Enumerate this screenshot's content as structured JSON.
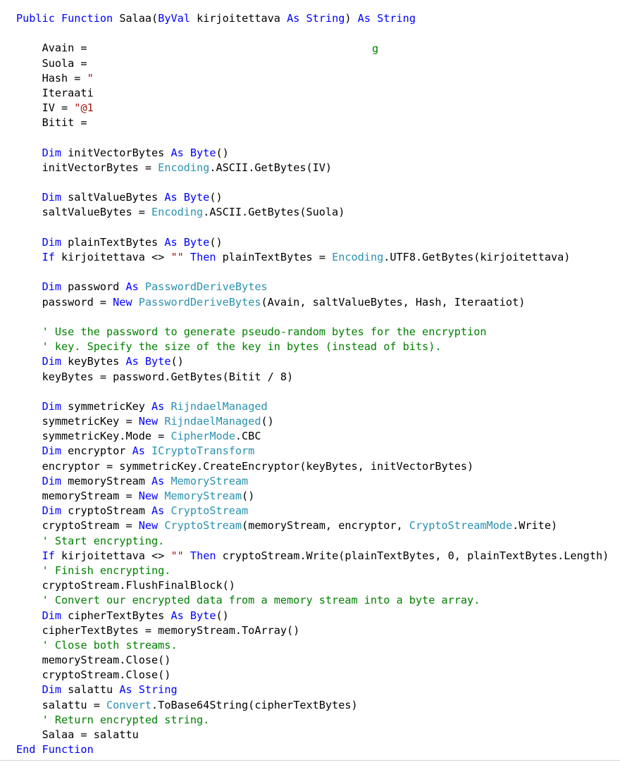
{
  "colors": {
    "keyword": "#0000ff",
    "type": "#2b91af",
    "string": "#a31515",
    "comment": "#008000",
    "plain": "#000000",
    "background": "#ffffff"
  },
  "stray_fragment": "g",
  "lines": [
    [
      [
        "kw",
        "Public Function "
      ],
      [
        "plain",
        "Salaa("
      ],
      [
        "kw",
        "ByVal "
      ],
      [
        "plain",
        "kirjoitettava "
      ],
      [
        "kw",
        "As String"
      ],
      [
        "plain",
        ") "
      ],
      [
        "kw",
        "As String"
      ]
    ],
    [],
    [
      [
        "plain",
        "    Avain = "
      ]
    ],
    [
      [
        "plain",
        "    Suola = "
      ]
    ],
    [
      [
        "plain",
        "    Hash = "
      ],
      [
        "str",
        "\""
      ]
    ],
    [
      [
        "plain",
        "    Iteraati"
      ]
    ],
    [
      [
        "plain",
        "    IV = "
      ],
      [
        "str",
        "\"@1"
      ]
    ],
    [
      [
        "plain",
        "    Bitit = "
      ]
    ],
    [],
    [
      [
        "plain",
        "    "
      ],
      [
        "kw",
        "Dim "
      ],
      [
        "plain",
        "initVectorBytes "
      ],
      [
        "kw",
        "As Byte"
      ],
      [
        "plain",
        "()"
      ]
    ],
    [
      [
        "plain",
        "    initVectorBytes = "
      ],
      [
        "type",
        "Encoding"
      ],
      [
        "plain",
        ".ASCII.GetBytes(IV)"
      ]
    ],
    [],
    [
      [
        "plain",
        "    "
      ],
      [
        "kw",
        "Dim "
      ],
      [
        "plain",
        "saltValueBytes "
      ],
      [
        "kw",
        "As Byte"
      ],
      [
        "plain",
        "()"
      ]
    ],
    [
      [
        "plain",
        "    saltValueBytes = "
      ],
      [
        "type",
        "Encoding"
      ],
      [
        "plain",
        ".ASCII.GetBytes(Suola)"
      ]
    ],
    [],
    [
      [
        "plain",
        "    "
      ],
      [
        "kw",
        "Dim "
      ],
      [
        "plain",
        "plainTextBytes "
      ],
      [
        "kw",
        "As Byte"
      ],
      [
        "plain",
        "()"
      ]
    ],
    [
      [
        "plain",
        "    "
      ],
      [
        "kw",
        "If "
      ],
      [
        "plain",
        "kirjoitettava <> "
      ],
      [
        "str",
        "\"\""
      ],
      [
        "plain",
        " "
      ],
      [
        "kw",
        "Then "
      ],
      [
        "plain",
        "plainTextBytes = "
      ],
      [
        "type",
        "Encoding"
      ],
      [
        "plain",
        ".UTF8.GetBytes(kirjoitettava)"
      ]
    ],
    [],
    [
      [
        "plain",
        "    "
      ],
      [
        "kw",
        "Dim "
      ],
      [
        "plain",
        "password "
      ],
      [
        "kw",
        "As "
      ],
      [
        "type",
        "PasswordDeriveBytes"
      ]
    ],
    [
      [
        "plain",
        "    password = "
      ],
      [
        "kw",
        "New "
      ],
      [
        "type",
        "PasswordDeriveBytes"
      ],
      [
        "plain",
        "(Avain, saltValueBytes, Hash, Iteraatiot)"
      ]
    ],
    [],
    [
      [
        "plain",
        "    "
      ],
      [
        "cm",
        "' Use the password to generate pseudo-random bytes for the encryption"
      ]
    ],
    [
      [
        "plain",
        "    "
      ],
      [
        "cm",
        "' key. Specify the size of the key in bytes (instead of bits)."
      ]
    ],
    [
      [
        "plain",
        "    "
      ],
      [
        "kw",
        "Dim "
      ],
      [
        "plain",
        "keyBytes "
      ],
      [
        "kw",
        "As Byte"
      ],
      [
        "plain",
        "()"
      ]
    ],
    [
      [
        "plain",
        "    keyBytes = password.GetBytes(Bitit / 8)"
      ]
    ],
    [],
    [
      [
        "plain",
        "    "
      ],
      [
        "kw",
        "Dim "
      ],
      [
        "plain",
        "symmetricKey "
      ],
      [
        "kw",
        "As "
      ],
      [
        "type",
        "RijndaelManaged"
      ]
    ],
    [
      [
        "plain",
        "    symmetricKey = "
      ],
      [
        "kw",
        "New "
      ],
      [
        "type",
        "RijndaelManaged"
      ],
      [
        "plain",
        "()"
      ]
    ],
    [
      [
        "plain",
        "    symmetricKey.Mode = "
      ],
      [
        "type",
        "CipherMode"
      ],
      [
        "plain",
        ".CBC"
      ]
    ],
    [
      [
        "plain",
        "    "
      ],
      [
        "kw",
        "Dim "
      ],
      [
        "plain",
        "encryptor "
      ],
      [
        "kw",
        "As "
      ],
      [
        "type",
        "ICryptoTransform"
      ]
    ],
    [
      [
        "plain",
        "    encryptor = symmetricKey.CreateEncryptor(keyBytes, initVectorBytes)"
      ]
    ],
    [
      [
        "plain",
        "    "
      ],
      [
        "kw",
        "Dim "
      ],
      [
        "plain",
        "memoryStream "
      ],
      [
        "kw",
        "As "
      ],
      [
        "type",
        "MemoryStream"
      ]
    ],
    [
      [
        "plain",
        "    memoryStream = "
      ],
      [
        "kw",
        "New "
      ],
      [
        "type",
        "MemoryStream"
      ],
      [
        "plain",
        "()"
      ]
    ],
    [
      [
        "plain",
        "    "
      ],
      [
        "kw",
        "Dim "
      ],
      [
        "plain",
        "cryptoStream "
      ],
      [
        "kw",
        "As "
      ],
      [
        "type",
        "CryptoStream"
      ]
    ],
    [
      [
        "plain",
        "    cryptoStream = "
      ],
      [
        "kw",
        "New "
      ],
      [
        "type",
        "CryptoStream"
      ],
      [
        "plain",
        "(memoryStream, encryptor, "
      ],
      [
        "type",
        "CryptoStreamMode"
      ],
      [
        "plain",
        ".Write)"
      ]
    ],
    [
      [
        "plain",
        "    "
      ],
      [
        "cm",
        "' Start encrypting."
      ]
    ],
    [
      [
        "plain",
        "    "
      ],
      [
        "kw",
        "If "
      ],
      [
        "plain",
        "kirjoitettava <> "
      ],
      [
        "str",
        "\"\""
      ],
      [
        "plain",
        " "
      ],
      [
        "kw",
        "Then "
      ],
      [
        "plain",
        "cryptoStream.Write(plainTextBytes, 0, plainTextBytes.Length)"
      ]
    ],
    [
      [
        "plain",
        "    "
      ],
      [
        "cm",
        "' Finish encrypting."
      ]
    ],
    [
      [
        "plain",
        "    cryptoStream.FlushFinalBlock()"
      ]
    ],
    [
      [
        "plain",
        "    "
      ],
      [
        "cm",
        "' Convert our encrypted data from a memory stream into a byte array."
      ]
    ],
    [
      [
        "plain",
        "    "
      ],
      [
        "kw",
        "Dim "
      ],
      [
        "plain",
        "cipherTextBytes "
      ],
      [
        "kw",
        "As Byte"
      ],
      [
        "plain",
        "()"
      ]
    ],
    [
      [
        "plain",
        "    cipherTextBytes = memoryStream.ToArray()"
      ]
    ],
    [
      [
        "plain",
        "    "
      ],
      [
        "cm",
        "' Close both streams."
      ]
    ],
    [
      [
        "plain",
        "    memoryStream.Close()"
      ]
    ],
    [
      [
        "plain",
        "    cryptoStream.Close()"
      ]
    ],
    [
      [
        "plain",
        "    "
      ],
      [
        "kw",
        "Dim "
      ],
      [
        "plain",
        "salattu "
      ],
      [
        "kw",
        "As String"
      ]
    ],
    [
      [
        "plain",
        "    salattu = "
      ],
      [
        "type",
        "Convert"
      ],
      [
        "plain",
        ".ToBase64String(cipherTextBytes)"
      ]
    ],
    [
      [
        "plain",
        "    "
      ],
      [
        "cm",
        "' Return encrypted string."
      ]
    ],
    [
      [
        "plain",
        "    Salaa = salattu"
      ]
    ],
    [
      [
        "kw",
        "End Function"
      ]
    ]
  ]
}
